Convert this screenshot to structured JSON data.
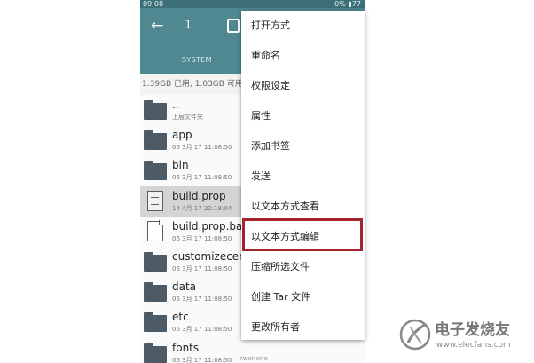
{
  "status_bar": {
    "time": "09:08",
    "right": "0%  ▮77"
  },
  "toolbar": {
    "back_icon": "arrow-left-icon",
    "selected_count": "1"
  },
  "tabs": {
    "current": "SYSTEM"
  },
  "storage": {
    "text": "1.39GB 已用, 1.03GB 可用"
  },
  "files": [
    {
      "name": "..",
      "meta": "上层文件夹",
      "type": "folder"
    },
    {
      "name": "app",
      "meta": "06 3月 17 11:08:50",
      "type": "folder"
    },
    {
      "name": "bin",
      "meta": "06 3月 17 11:08:50",
      "type": "folder"
    },
    {
      "name": "build.prop",
      "meta": "14 4月 17 22:18:04",
      "type": "file",
      "selected": true
    },
    {
      "name": "build.prop.bak",
      "meta": "06 3月 17 11:08:50",
      "type": "file"
    },
    {
      "name": "customizecent",
      "meta": "06 3月 17 11:08:50",
      "type": "folder"
    },
    {
      "name": "data",
      "meta": "06 3月 17 11:08:50",
      "type": "folder"
    },
    {
      "name": "etc",
      "meta": "06 3月 17 11:08:50",
      "type": "folder"
    },
    {
      "name": "fonts",
      "meta": "06 3月 17 11:08:50",
      "type": "folder",
      "permission": "rwxr-xr-x"
    }
  ],
  "menu": {
    "items": [
      "打开方式",
      "重命名",
      "权限设定",
      "属性",
      "添加书签",
      "发送",
      "以文本方式查看",
      "以文本方式编辑",
      "压缩所选文件",
      "创建 Tar 文件",
      "更改所有者"
    ],
    "highlighted": "以文本方式编辑"
  },
  "watermark": {
    "text": "电子发烧友",
    "url": "www.elecfans.com"
  },
  "colors": {
    "toolbar": "#4f8891",
    "highlight_border": "#a5232a"
  }
}
